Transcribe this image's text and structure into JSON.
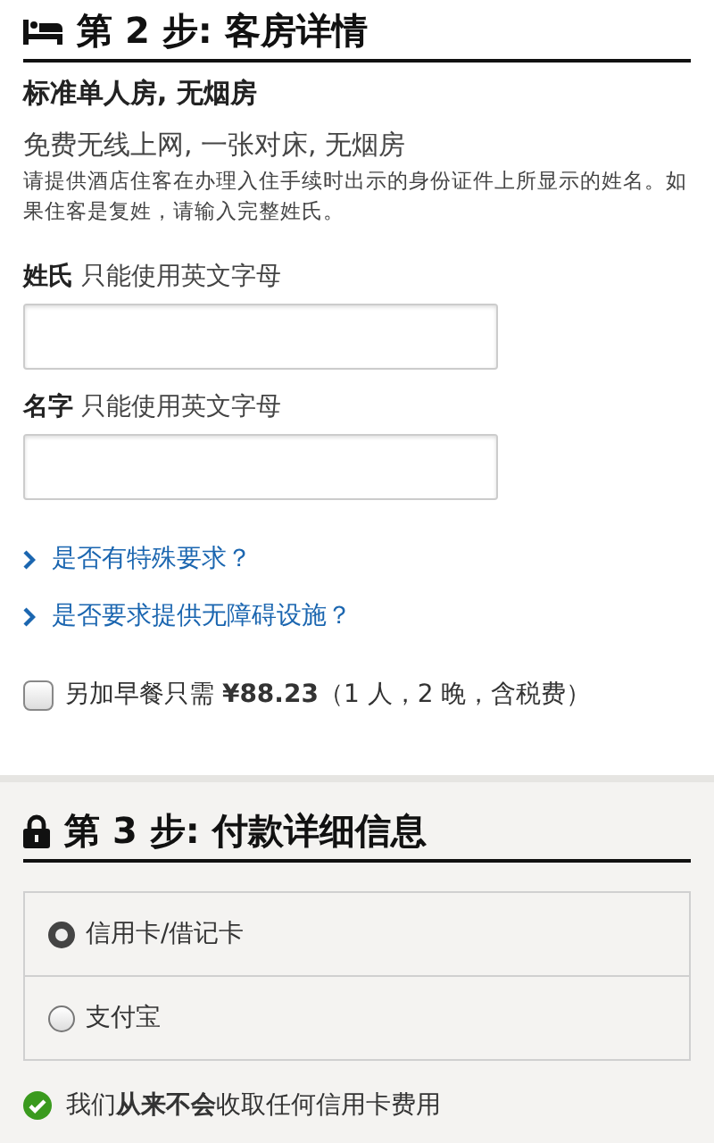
{
  "room_section": {
    "heading": "第 2 步: 客房详情",
    "room_name": "标准单人房, 无烟房",
    "features": "免费无线上网, 一张对床, 无烟房",
    "note": "请提供酒店住客在办理入住手续时出示的身份证件上所显示的姓名。如果住客是复姓，请输入完整姓氏。",
    "fields": [
      {
        "label": "姓氏",
        "hint": "只能使用英文字母"
      },
      {
        "label": "名字",
        "hint": "只能使用英文字母"
      }
    ],
    "links": [
      "是否有特殊要求？",
      "是否要求提供无障碍设施？"
    ],
    "breakfast": {
      "label": "另加早餐只需 **¥88.23**（1 人，2 晚，含税费）",
      "checked": false
    }
  },
  "payment_section": {
    "heading": "第 3 步: 付款详细信息",
    "options": [
      {
        "label": "信用卡/借记卡",
        "selected": true
      },
      {
        "label": "支付宝",
        "selected": false
      }
    ],
    "guarantee": "我们**从来不会**收取任何信用卡费用"
  }
}
